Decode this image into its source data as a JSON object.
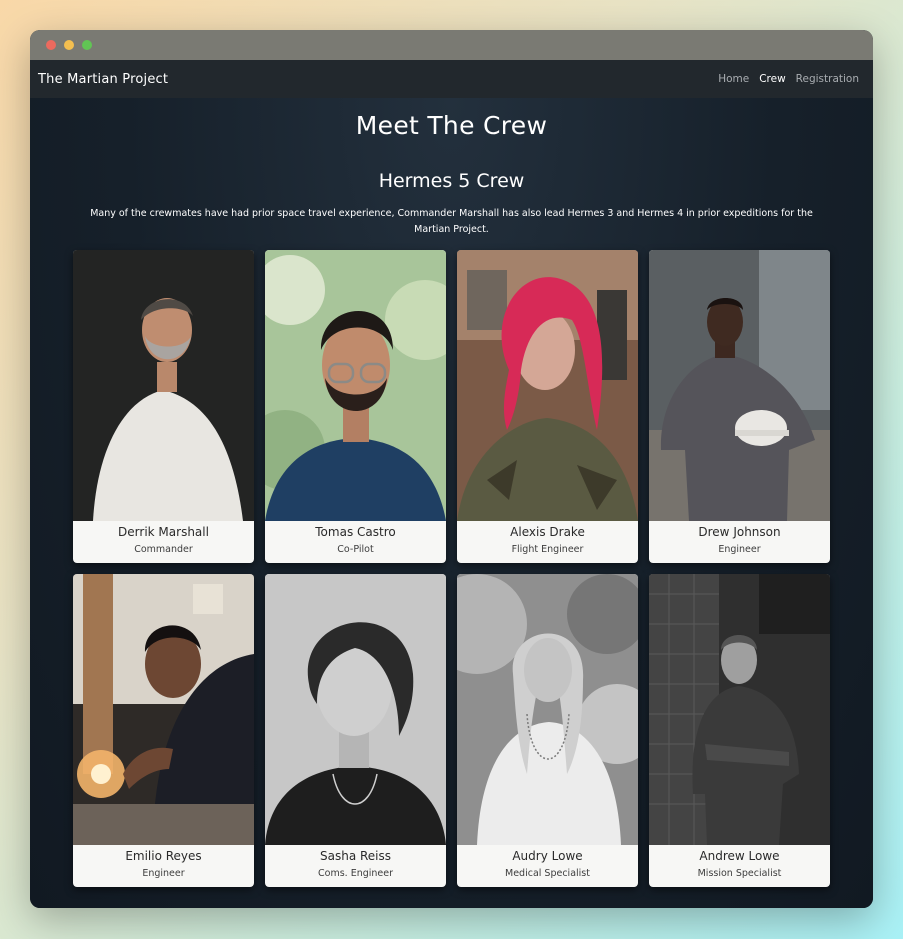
{
  "navbar": {
    "brand": "The Martian Project",
    "links": [
      {
        "label": "Home",
        "active": false
      },
      {
        "label": "Crew",
        "active": true
      },
      {
        "label": "Registration",
        "active": false
      }
    ]
  },
  "page": {
    "title": "Meet The Crew",
    "section_title": "Hermes 5 Crew",
    "intro": "Many of the crewmates have had prior space travel experience, Commander Marshall has also lead Hermes 3 and Hermes 4 in prior expeditions for the Martian Project."
  },
  "crew": [
    {
      "name": "Derrik Marshall",
      "role": "Commander"
    },
    {
      "name": "Tomas Castro",
      "role": "Co-Pilot"
    },
    {
      "name": "Alexis Drake",
      "role": "Flight Engineer"
    },
    {
      "name": "Drew Johnson",
      "role": "Engineer"
    },
    {
      "name": "Emilio Reyes",
      "role": "Engineer"
    },
    {
      "name": "Sasha Reiss",
      "role": "Coms. Engineer"
    },
    {
      "name": "Audry Lowe",
      "role": "Medical Specialist"
    },
    {
      "name": "Andrew Lowe",
      "role": "Mission Specialist"
    }
  ],
  "colors": {
    "page_background": "#16202a",
    "navbar_background": "#22282d",
    "card_background": "#f7f7f5"
  }
}
